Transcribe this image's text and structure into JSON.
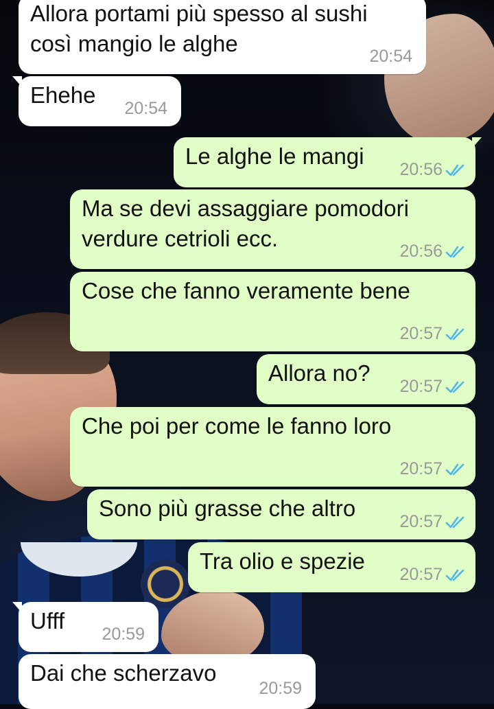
{
  "colors": {
    "incoming_bubble": "#ffffff",
    "outgoing_bubble": "#e1fec6",
    "timestamp": "#999999",
    "read_ticks": "#4fb6ec"
  },
  "messages": [
    {
      "direction": "incoming",
      "text": "Allora portami più spesso al sushi\ncosì mangio le alghe",
      "time": "20:54"
    },
    {
      "direction": "incoming",
      "text": "Ehehe",
      "time": "20:54"
    },
    {
      "direction": "outgoing",
      "text": "Le alghe le mangi",
      "time": "20:56",
      "status_icon": "double-check-read-icon"
    },
    {
      "direction": "outgoing",
      "text": "Ma se devi assaggiare pomodori\nverdure cetrioli ecc.",
      "time": "20:56",
      "status_icon": "double-check-read-icon"
    },
    {
      "direction": "outgoing",
      "text": "Cose che fanno veramente bene",
      "time": "20:57",
      "status_icon": "double-check-read-icon"
    },
    {
      "direction": "outgoing",
      "text": "Allora no?",
      "time": "20:57",
      "status_icon": "double-check-read-icon"
    },
    {
      "direction": "outgoing",
      "text": "Che poi per come le fanno loro",
      "time": "20:57",
      "status_icon": "double-check-read-icon"
    },
    {
      "direction": "outgoing",
      "text": "Sono più grasse che altro",
      "time": "20:57",
      "status_icon": "double-check-read-icon"
    },
    {
      "direction": "outgoing",
      "text": "Tra olio e spezie",
      "time": "20:57",
      "status_icon": "double-check-read-icon"
    },
    {
      "direction": "incoming",
      "text": "Ufff",
      "time": "20:59"
    },
    {
      "direction": "incoming",
      "text": "Dai che scherzavo",
      "time": "20:59"
    }
  ]
}
